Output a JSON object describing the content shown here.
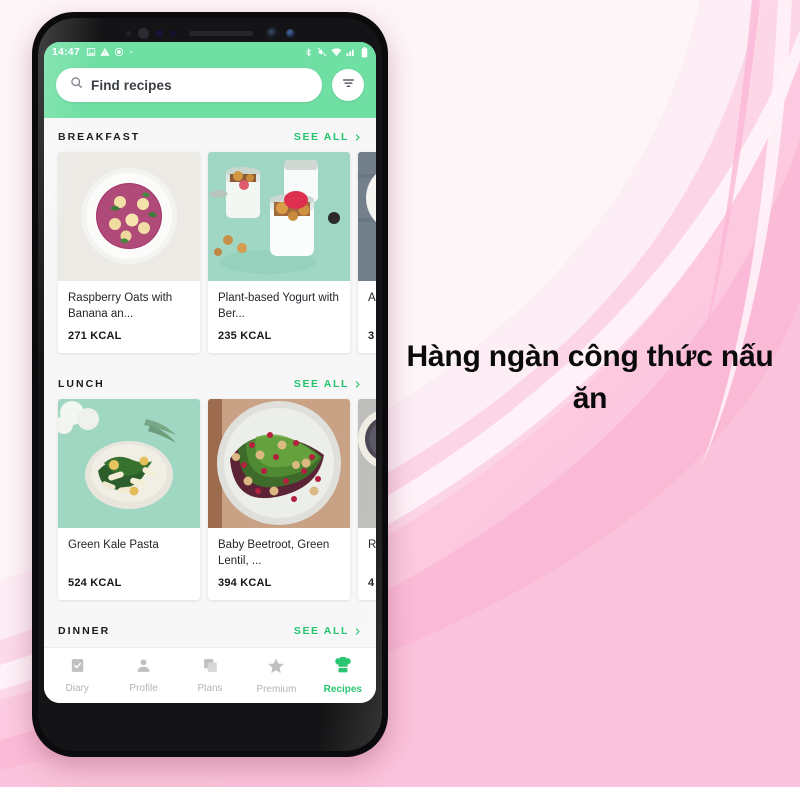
{
  "headline": "Hàng ngàn công thức nấu ăn",
  "colors": {
    "accent_green": "#25c36e",
    "header_green": "#6fdfa4",
    "background_pink": "#fbd6e4",
    "card_white": "#ffffff"
  },
  "statusbar": {
    "time": "14:47",
    "left_icons": [
      "image-icon",
      "warning-triangle-icon",
      "record-circle-icon",
      "dot-icon"
    ],
    "right_icons": [
      "bluetooth-icon",
      "mute-icon",
      "wifi-icon",
      "signal-icon",
      "battery-icon"
    ]
  },
  "search": {
    "placeholder": "Find recipes",
    "icon": "search-icon",
    "filter_icon": "filter-icon"
  },
  "sections": [
    {
      "title": "BREAKFAST",
      "see_all": "SEE ALL",
      "cards": [
        {
          "title": "Raspberry Oats with Banana an...",
          "kcal": "271 KCAL"
        },
        {
          "title": "Plant-based Yogurt with Ber...",
          "kcal": "235 KCAL"
        },
        {
          "title": "A B",
          "kcal": "3"
        }
      ]
    },
    {
      "title": "LUNCH",
      "see_all": "SEE ALL",
      "cards": [
        {
          "title": "Green Kale Pasta",
          "kcal": "524 KCAL"
        },
        {
          "title": "Baby Beetroot, Green Lentil, ...",
          "kcal": "394 KCAL"
        },
        {
          "title": "R",
          "kcal": "4"
        }
      ]
    },
    {
      "title": "DINNER",
      "see_all": "SEE ALL",
      "cards": []
    }
  ],
  "bottom_nav": [
    {
      "label": "Diary",
      "icon": "diary-icon",
      "active": false
    },
    {
      "label": "Profile",
      "icon": "profile-icon",
      "active": false
    },
    {
      "label": "Plans",
      "icon": "plans-icon",
      "active": false
    },
    {
      "label": "Premium",
      "icon": "star-icon",
      "active": false
    },
    {
      "label": "Recipes",
      "icon": "chef-hat-icon",
      "active": true
    }
  ]
}
